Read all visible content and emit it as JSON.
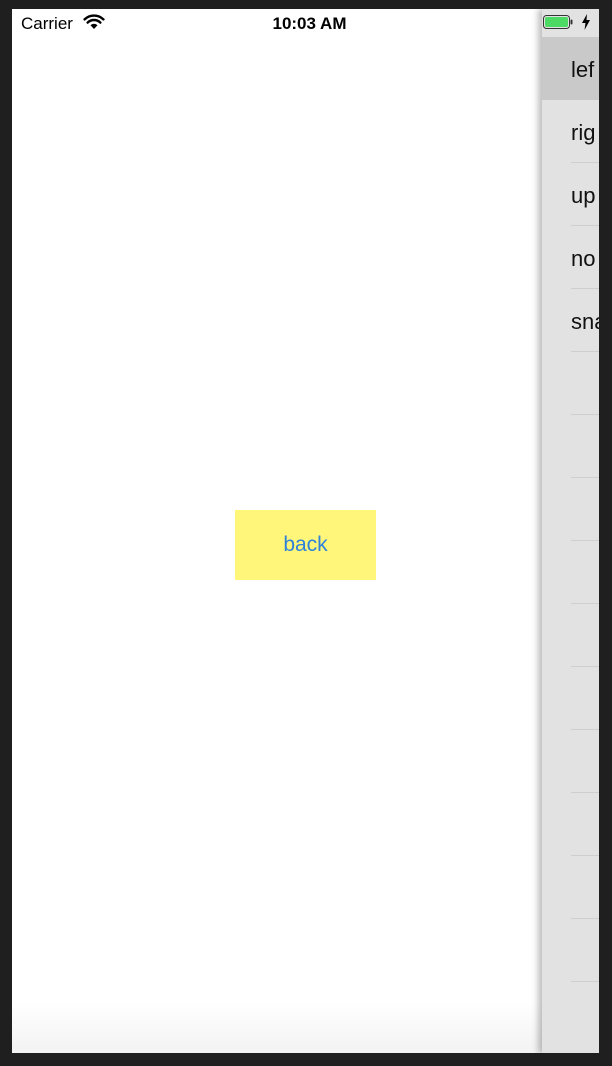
{
  "status_bar": {
    "carrier": "Carrier",
    "time": "10:03 AM",
    "battery_color": "#4cd964"
  },
  "main": {
    "back_label": "back",
    "button_color": "#fff67a",
    "button_text_color": "#2f82d9"
  },
  "drawer": {
    "items": [
      "lef",
      "rig",
      "up",
      "no",
      "sna",
      "",
      "",
      "",
      "",
      "",
      "",
      "",
      "",
      "",
      ""
    ]
  }
}
